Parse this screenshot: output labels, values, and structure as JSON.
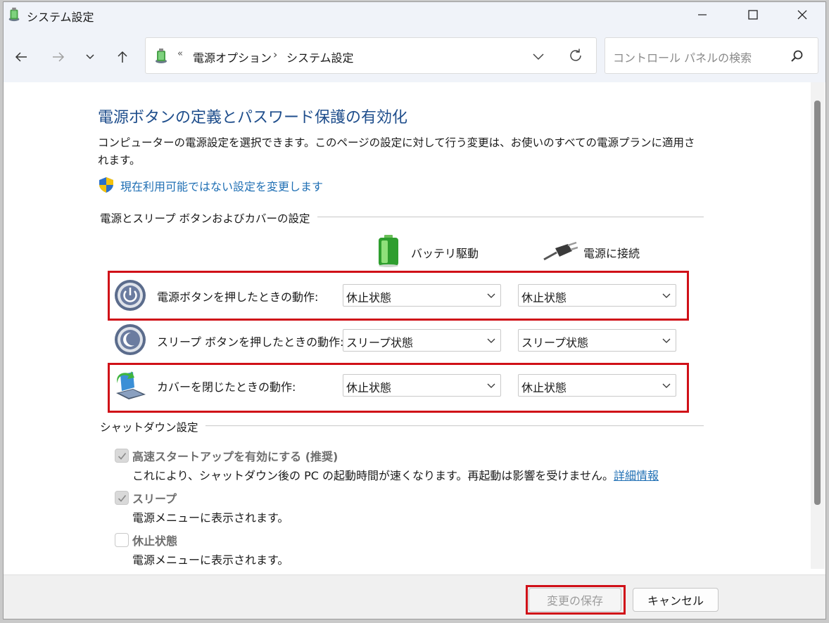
{
  "window": {
    "title": "システム設定"
  },
  "nav": {
    "breadcrumb_chevron": "«",
    "breadcrumbs": [
      "電源オプション",
      "システム設定"
    ],
    "breadcrumb_separator": "›",
    "search_placeholder": "コントロール パネルの検索"
  },
  "page": {
    "title": "電源ボタンの定義とパスワード保護の有効化",
    "description": "コンピューターの電源設定を選択できます。このページの設定に対して行う変更は、お使いのすべての電源プランに適用されます。",
    "admin_link": "現在利用可能ではない設定を変更します"
  },
  "power_section": {
    "label": "電源とスリープ ボタンおよびカバーの設定",
    "columns": {
      "battery": "バッテリ駆動",
      "plugged": "電源に接続"
    },
    "rows": [
      {
        "label": "電源ボタンを押したときの動作:",
        "battery": "休止状態",
        "plugged": "休止状態"
      },
      {
        "label": "スリープ ボタンを押したときの動作:",
        "battery": "スリープ状態",
        "plugged": "スリープ状態"
      },
      {
        "label": "カバーを閉じたときの動作:",
        "battery": "休止状態",
        "plugged": "休止状態"
      }
    ]
  },
  "shutdown_section": {
    "label": "シャットダウン設定",
    "items": [
      {
        "label": "高速スタートアップを有効にする (推奨)",
        "desc": "これにより、シャットダウン後の PC の起動時間が速くなります。再起動は影響を受けません。",
        "link": "詳細情報",
        "checked": true
      },
      {
        "label": "スリープ",
        "desc": "電源メニューに表示されます。",
        "checked": true
      },
      {
        "label": "休止状態",
        "desc": "電源メニューに表示されます。",
        "checked": false
      }
    ]
  },
  "footer": {
    "save": "変更の保存",
    "cancel": "キャンセル"
  },
  "colors": {
    "title_blue": "#1f4e8c",
    "link_blue": "#1f6fb4",
    "highlight_red": "#d01018"
  }
}
